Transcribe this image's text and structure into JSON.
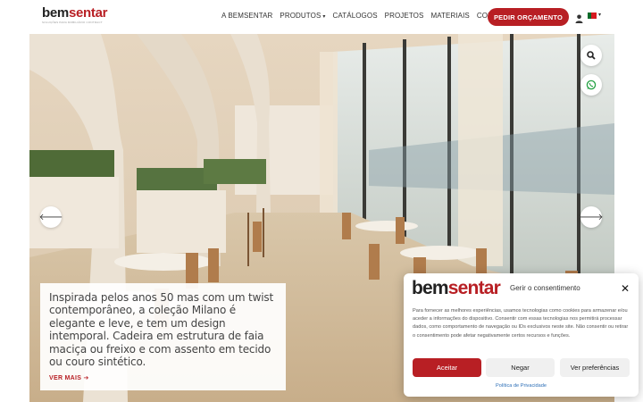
{
  "header": {
    "logo": {
      "part1": "bem",
      "part2": "sentar",
      "tagline": "SOLUÇÕES PARA MOBILIÁRIO CONTRACT"
    },
    "nav": [
      {
        "label": "A BEMSENTAR",
        "has_dropdown": false
      },
      {
        "label": "PRODUTOS",
        "has_dropdown": true
      },
      {
        "label": "CATÁLOGOS",
        "has_dropdown": false
      },
      {
        "label": "PROJETOS",
        "has_dropdown": false
      },
      {
        "label": "MATERIAIS",
        "has_dropdown": false
      },
      {
        "label": "CONTACTOS",
        "has_dropdown": false
      }
    ],
    "cta_label": "PEDIR ORÇAMENTO",
    "user_icon": "user-icon",
    "language_flag": "portugal-flag-icon",
    "dropdown_caret": "▾"
  },
  "hero": {
    "caption": "Inspirada pelos anos 50 mas com um twist contemporâneo, a coleção Milano é elegante e leve, e tem um design intemporal. Cadeira em estrutura de faia maciça ou freixo e com assento em tecido ou couro sintético.",
    "link_label": "VER MAIS",
    "link_arrow": "➔",
    "prev_icon": "arrow-left-icon",
    "next_icon": "arrow-right-icon",
    "prev_glyph": "🡐",
    "next_glyph": "🡒"
  },
  "floating": {
    "search_icon": "search-icon",
    "whatsapp_icon": "whatsapp-icon"
  },
  "consent": {
    "logo_part1": "bem",
    "logo_part2": "sentar",
    "title": "Gerir o consentimento",
    "close_glyph": "✕",
    "body": "Para fornecer as melhores experiências, usamos tecnologias como cookies para armazenar e/ou aceder a informações do dispositivo. Consentir com essas tecnologias nos permitirá processar dados, como comportamento de navegação ou IDs exclusivos neste site. Não consentir ou retirar o consentimento pode afetar negativamente certos recursos e funções.",
    "accept_label": "Aceitar",
    "deny_label": "Negar",
    "prefs_label": "Ver preferências",
    "privacy_label": "Política de Privacidade"
  },
  "colors": {
    "brand_red": "#b81f24",
    "link_blue": "#2d6fb7"
  }
}
